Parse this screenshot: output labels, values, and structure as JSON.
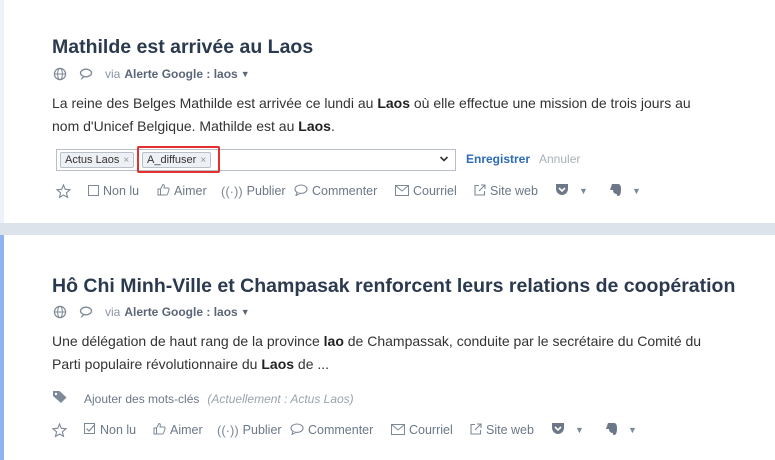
{
  "article1": {
    "title": "Mathilde est arrivée au Laos",
    "via": "via",
    "source": "Alerte Google : laos",
    "body_1": "La reine des Belges Mathilde est arrivée ce lundi au ",
    "body_b1": "Laos",
    "body_2": " où elle effectue une mission de trois jours au nom d'Unicef Belgique. Mathilde est au ",
    "body_b2": "Laos",
    "body_3": ".",
    "tags": [
      "Actus Laos",
      "A_diffuser"
    ],
    "tag_remove": "×",
    "save_label": "Enregistrer",
    "cancel_label": "Annuler"
  },
  "article2": {
    "title": "Hô Chi Minh-Ville et Champasak renforcent leurs relations de coopération",
    "via": "via",
    "source": "Alerte Google : laos",
    "body_1": "Une délégation de haut rang de la province ",
    "body_b1": "lao",
    "body_2": " de Champassak, conduite par le secrétaire du Comité du Parti populaire révolutionnaire du ",
    "body_b2": "Laos",
    "body_3": " de ...",
    "add_keywords": "Ajouter des mots-clés",
    "current_keywords": "(Actuellement : Actus Laos)"
  },
  "actions": {
    "not_read": "Non lu",
    "like": "Aimer",
    "publish": "Publier",
    "comment": "Commenter",
    "email": "Courriel",
    "website": "Site web"
  },
  "icons": [
    "globe-icon",
    "feed-icon",
    "chevron-down-icon",
    "star-icon",
    "checkbox-icon",
    "thumbs-up-icon",
    "broadcast-icon",
    "comment-icon",
    "mail-icon",
    "external-link-icon",
    "pocket-icon",
    "evernote-icon",
    "tag-icon"
  ],
  "colors": {
    "title": "#2b3a4f",
    "link": "#2b6bb8",
    "highlight": "#e23030",
    "accent_bar": "#8fb3f0"
  }
}
